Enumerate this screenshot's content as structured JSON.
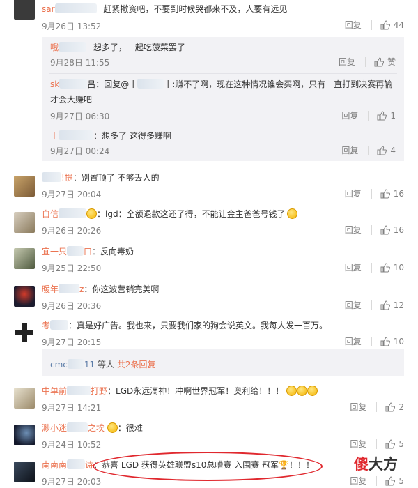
{
  "labels": {
    "reply": "回复",
    "like_word": "赞"
  },
  "comments": [
    {
      "user_prefix": "sar",
      "text": "赶紧撤资吧，不要到时候哭都来不及，人要有远见",
      "time": "9月26日 13:52",
      "likes": "44"
    },
    {
      "user_prefix": "",
      "user_suffix": "!提",
      "text": "：别置顶了 不够丢人的",
      "time": "9月27日 20:04",
      "likes": "16"
    },
    {
      "user_prefix": "自信",
      "text": "：lgd：全额退款这还了得，不能让金主爸爸号钱了",
      "time": "9月26日 20:26",
      "likes": "16"
    },
    {
      "user_prefix": "宜一只",
      "user_suffix": "口",
      "text": "：反向毒奶",
      "time": "9月25日 22:50",
      "likes": "10"
    },
    {
      "user_prefix": "暖年",
      "user_suffix": "z",
      "text": "：你这波营销完美啊",
      "time": "9月26日 20:36",
      "likes": "12"
    },
    {
      "user_prefix": "考",
      "text": "：真是好广告。我也来，只要我们家的狗会说英文。我每人发一百万。",
      "time": "9月27日 20:15",
      "likes": "10"
    },
    {
      "user_prefix": "中单前",
      "user_suffix": "打野",
      "text": "：LGD永远滴神！冲啊世界冠军！奥利给！！！",
      "time": "9月27日 14:21",
      "likes": "2"
    },
    {
      "user_prefix": "渺小迷",
      "user_suffix": "之埃",
      "text": "：很难",
      "time": "9月24日 10:52",
      "likes": "5"
    },
    {
      "user_prefix": "南南南",
      "user_suffix": "诗",
      "text": "：恭喜 LGD 获得英雄联盟s10总嘈赛 入围赛 冠军",
      "text_end": "！！！",
      "time": "9月27日 20:03",
      "likes": "5"
    }
  ],
  "subreplies": [
    {
      "user_prefix": "哦",
      "text": "想多了，一起吃菠菜罢了",
      "time": "9月28日 11:55",
      "likes": "赞"
    },
    {
      "user_prefix": "sk",
      "text": "吕：回复@丨",
      "text_b": "丨:赚不了啊，现在这种情况谁会买啊，只有一直打到决赛再输才会大赚吧",
      "time": "9月27日 06:30",
      "likes": "1"
    },
    {
      "user_prefix": "丨",
      "text": "：想多了 这得多赚啊",
      "time": "9月27日 00:24",
      "likes": "4"
    }
  ],
  "more_replies": {
    "user_prefix": "cmc",
    "user_suffix": "11",
    "text": "等人",
    "link": "共2条回复"
  },
  "watermark": {
    "text1": "傻",
    "text2": "大方"
  },
  "colors": {
    "username": "#eb7350",
    "meta": "#808080",
    "accent_red": "#e0282e",
    "subbox_bg": "#f2f2f5"
  }
}
